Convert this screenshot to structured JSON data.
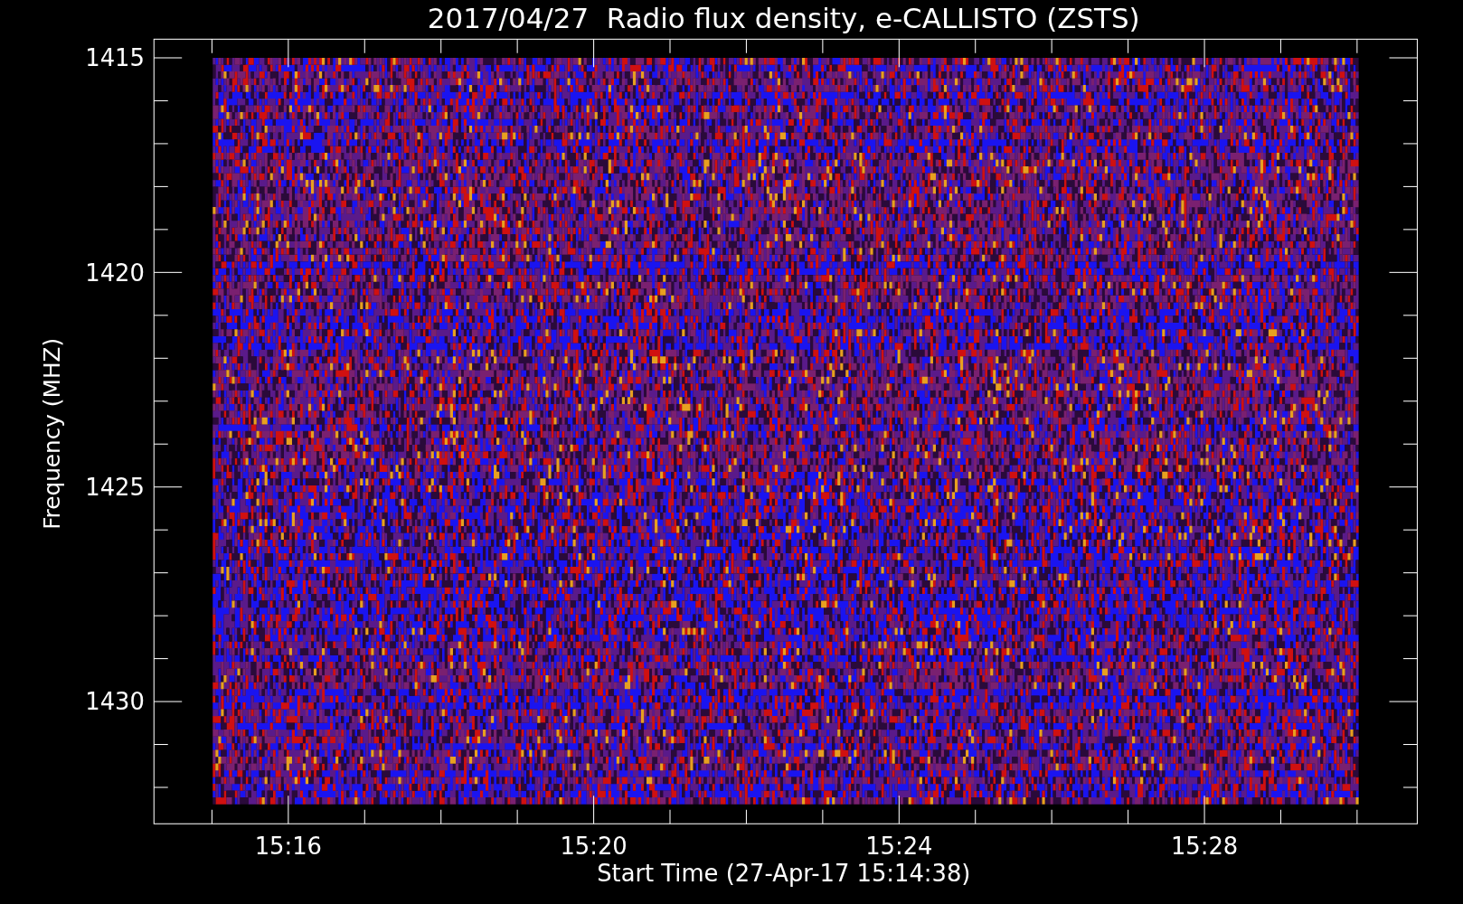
{
  "title": "2017/04/27  Radio flux density, e-CALLISTO (ZSTS)",
  "ylabel": "Frequency (MHZ)",
  "xlabel": "Start Time (27-Apr-17 15:14:38)",
  "yticks": [
    "1415",
    "1420",
    "1425",
    "1430"
  ],
  "xticks": [
    "15:16",
    "15:20",
    "15:24",
    "15:28"
  ]
}
